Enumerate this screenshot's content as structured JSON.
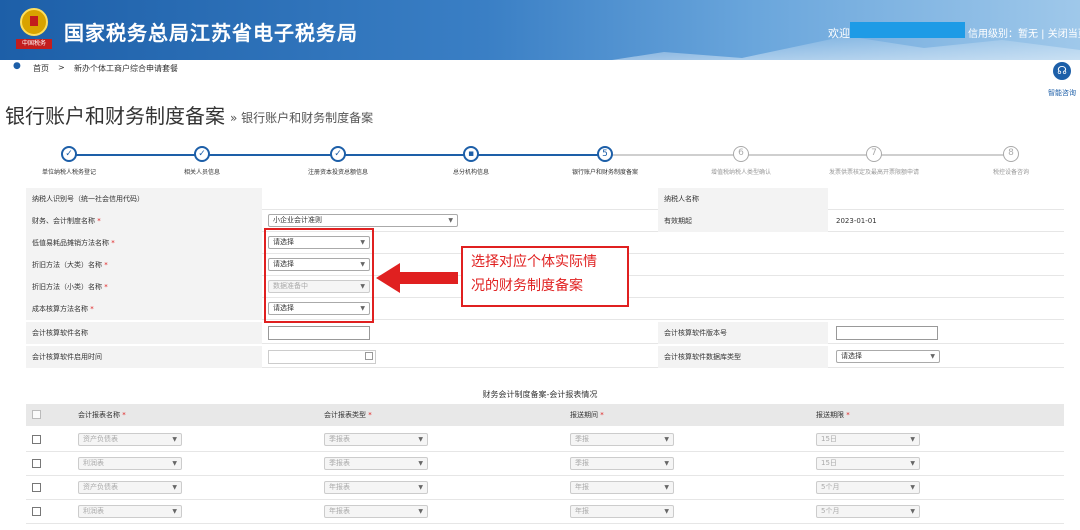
{
  "header": {
    "site_title": "国家税务总局江苏省电子税务局",
    "logo_tag": "中国税务",
    "welcome": "欢迎",
    "credit_text": "信用级别：暂无 | 关闭当页"
  },
  "breadcrumb": {
    "home": "首页",
    "separator": ">",
    "current": "新办个体工商户综合申请套餐"
  },
  "assistant": {
    "label": "智能咨询"
  },
  "page": {
    "title": "银行账户和财务制度备案",
    "subtitle": "» 银行账户和财务制度备案"
  },
  "steps": [
    {
      "label": "单位纳税人税务登记",
      "status": "done",
      "icon": "check-icon"
    },
    {
      "label": "相关人员信息",
      "status": "done",
      "icon": "check-icon"
    },
    {
      "label": "注册资本投资总额信息",
      "status": "done",
      "icon": "check-icon"
    },
    {
      "label": "总分机构信息",
      "status": "done",
      "icon": "lock-icon"
    },
    {
      "label": "银行账户和财务制度备案",
      "status": "current",
      "number": "5"
    },
    {
      "label": "增值税纳税人类型确认",
      "status": "todo",
      "number": "6"
    },
    {
      "label": "发票供票核定及最高开票限额申请",
      "status": "todo",
      "number": "7"
    },
    {
      "label": "税控设备咨询",
      "status": "todo",
      "number": "8"
    }
  ],
  "form": {
    "taxpayer_id_label": "纳税人识别号（统一社会信用代码）",
    "taxpayer_name_label": "纳税人名称",
    "accounting_system_label": "财务、会计制度名称",
    "accounting_system_value": "小企业会计准则",
    "valid_from_label": "有效期起",
    "valid_from_value": "2023-01-01",
    "low_value_label": "低值易耗品摊销方法名称",
    "low_value_value": "请选择",
    "depreciation_major_label": "折旧方法（大类）名称",
    "depreciation_major_value": "请选择",
    "depreciation_minor_label": "折旧方法（小类）名称",
    "depreciation_minor_value": "数据准备中",
    "cost_method_label": "成本核算方法名称",
    "cost_method_value": "请选择",
    "software_name_label": "会计核算软件名称",
    "software_version_label": "会计核算软件版本号",
    "software_date_label": "会计核算软件启用时间",
    "software_db_label": "会计核算软件数据库类型",
    "software_db_value": "请选择"
  },
  "callout": {
    "line1": "选择对应个体实际情",
    "line2": "况的财务制度备案"
  },
  "report_section": {
    "title": "财务会计制度备案-会计报表情况",
    "headers": [
      "会计报表名称",
      "会计报表类型",
      "报送期间",
      "报送期限"
    ],
    "rows": [
      [
        "资产负债表",
        "季报表",
        "季报",
        "15日"
      ],
      [
        "利润表",
        "季报表",
        "季报",
        "15日"
      ],
      [
        "资产负债表",
        "年报表",
        "年报",
        "5个月"
      ],
      [
        "利润表",
        "年报表",
        "年报",
        "5个月"
      ]
    ]
  }
}
